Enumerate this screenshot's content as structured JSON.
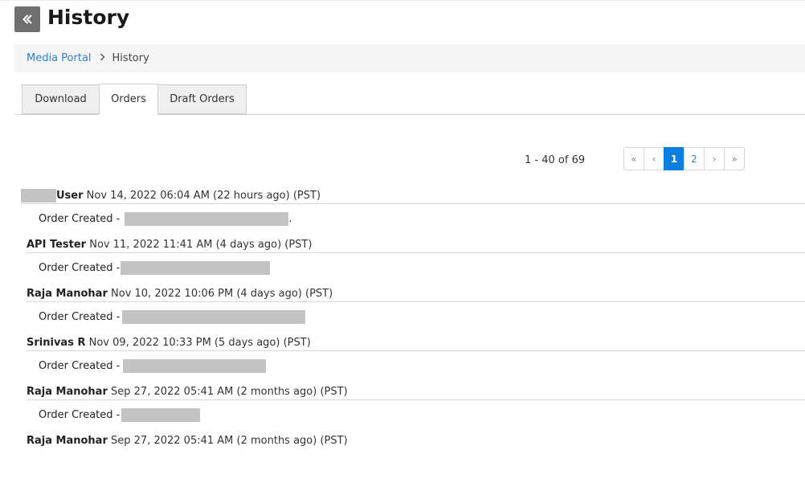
{
  "header": {
    "back_icon": "double-chevron-left-icon",
    "title": "History"
  },
  "breadcrumb": {
    "items": [
      "Media Portal",
      "History"
    ],
    "separator_icon": "chevron-right-icon"
  },
  "tabs": [
    {
      "label": "Download",
      "active": false
    },
    {
      "label": "Orders",
      "active": true
    },
    {
      "label": "Draft Orders",
      "active": false
    }
  ],
  "pagination": {
    "summary": "1 - 40 of 69",
    "first": "«",
    "prev": "‹",
    "pages": [
      "1",
      "2"
    ],
    "current": "1",
    "next": "›",
    "last": "»"
  },
  "entries": [
    {
      "user": "User",
      "when": "Nov 14, 2022 06:04 AM (22 hours ago) (PST)",
      "action": "Order Created -",
      "after": "."
    },
    {
      "user": "API Tester",
      "when": "Nov 11, 2022 11:41 AM (4 days ago) (PST)",
      "action": "Order Created -",
      "after": ""
    },
    {
      "user": "Raja Manohar",
      "when": "Nov 10, 2022 10:06 PM (4 days ago) (PST)",
      "action": "Order Created -",
      "after": ""
    },
    {
      "user": "Srinivas R",
      "when": "Nov 09, 2022 10:33 PM (5 days ago) (PST)",
      "action": "Order Created -",
      "after": ""
    },
    {
      "user": "Raja Manohar",
      "when": "Sep 27, 2022 05:41 AM (2 months ago) (PST)",
      "action": "Order Created -",
      "after": ""
    },
    {
      "user": "Raja Manohar",
      "when": "Sep 27, 2022 05:41 AM (2 months ago) (PST)",
      "action": "",
      "after": ""
    }
  ],
  "colors": {
    "accent": "#0e7fe0",
    "link": "#2f7fd1",
    "back_button": "#6f6f6f",
    "redaction": "#c3c3c3"
  }
}
